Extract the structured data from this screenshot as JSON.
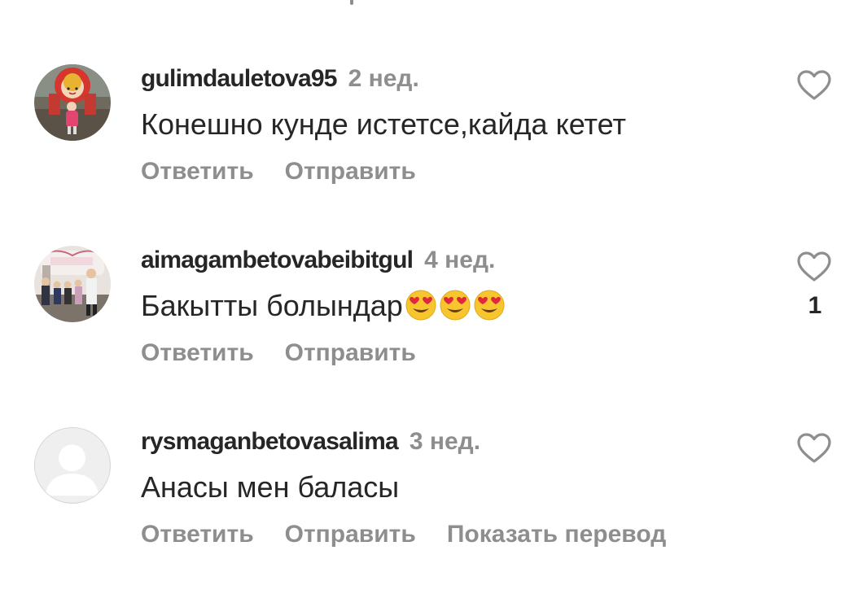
{
  "comments": [
    {
      "username": "gulimdauletova95",
      "time": "2 нед.",
      "text": "Конешно кунде истетсе,кайда кетет",
      "reply_label": "Ответить",
      "send_label": "Отправить",
      "like_count": ""
    },
    {
      "username": "aimagambetovabeibitgul",
      "time": "4 нед.",
      "text": "Бакытты болындар",
      "emoji": [
        "heart-eyes-emoji",
        "heart-eyes-emoji",
        "heart-eyes-emoji"
      ],
      "reply_label": "Ответить",
      "send_label": "Отправить",
      "like_count": "1"
    },
    {
      "username": "rysmaganbetovasalima",
      "time": "3 нед.",
      "text": "Анасы мен баласы",
      "reply_label": "Ответить",
      "send_label": "Отправить",
      "translate_label": "Показать перевод",
      "like_count": ""
    }
  ],
  "colors": {
    "primary_text": "#262626",
    "secondary_text": "#8e8e8e",
    "background": "#ffffff"
  },
  "icons": {
    "like": "heart-outline-icon"
  }
}
